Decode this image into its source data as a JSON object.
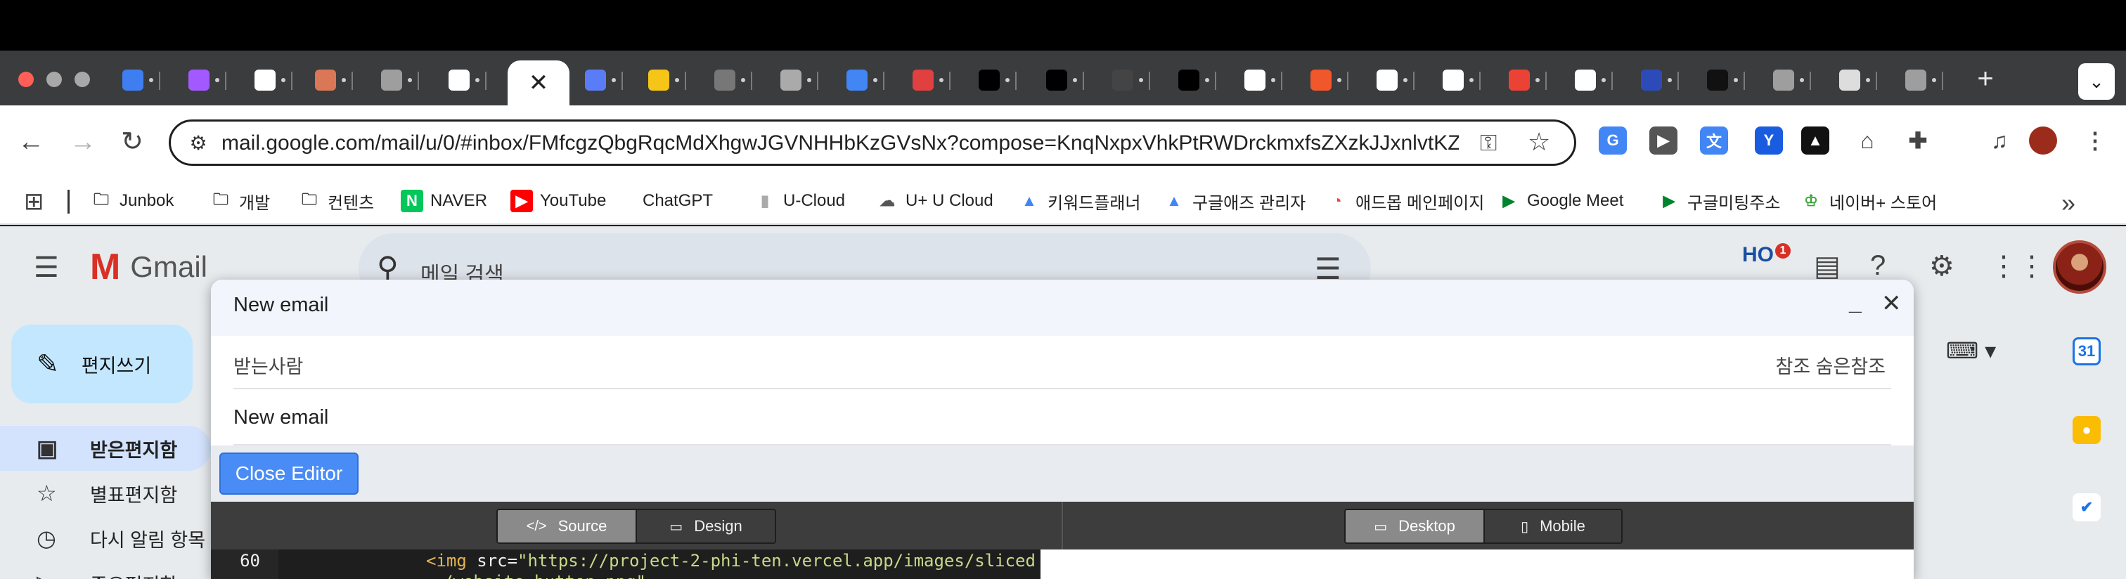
{
  "browser": {
    "tabs": [
      {
        "icon": "diamond-icon",
        "color": "#3f7ef0"
      },
      {
        "icon": "figma-icon",
        "color": "#a259ff"
      },
      {
        "icon": "openai-icon",
        "color": "#ffffff"
      },
      {
        "icon": "claude-icon",
        "color": "#d97757"
      },
      {
        "icon": "globe-icon",
        "color": "#9e9e9e"
      },
      {
        "icon": "slash-icon",
        "color": "#ffffff"
      },
      {
        "icon": "docs-icon",
        "color": "#5b7cf7"
      },
      {
        "icon": "yellow-face-icon",
        "color": "#f5c518"
      },
      {
        "icon": "globe-icon",
        "color": "#777777"
      },
      {
        "icon": "spinner-icon",
        "color": "#aaaaaa"
      },
      {
        "icon": "google-icon",
        "color": "#4285f4"
      },
      {
        "icon": "avatar-icon",
        "color": "#e04040"
      },
      {
        "icon": "triangle-icon",
        "color": "#000000"
      },
      {
        "icon": "triangle-icon",
        "color": "#000000"
      },
      {
        "icon": "github-icon",
        "color": "#444444"
      },
      {
        "icon": "triangle-icon",
        "color": "#000000"
      },
      {
        "icon": "openai-icon",
        "color": "#ffffff"
      },
      {
        "icon": "orange-square-icon",
        "color": "#f0572b"
      },
      {
        "icon": "rounded-square-icon",
        "color": "#ffffff"
      },
      {
        "icon": "rounded-square-icon",
        "color": "#ffffff"
      },
      {
        "icon": "gmail-icon",
        "color": "#ea4335"
      },
      {
        "icon": "rounded-square-icon",
        "color": "#ffffff"
      },
      {
        "icon": "blue-app-icon",
        "color": "#2d4bb8"
      },
      {
        "icon": "tiktok-icon",
        "color": "#111111"
      },
      {
        "icon": "globe-icon",
        "color": "#9e9e9e"
      },
      {
        "icon": "puzzle-icon",
        "color": "#dddddd"
      },
      {
        "icon": "globe-icon",
        "color": "#9e9e9e"
      }
    ],
    "active_tab_close": "✕",
    "new_tab": "+",
    "url": "mail.google.com/mail/u/0/#inbox/FMfcgzQbgRqcMdXhgwJGVNHHbKzGVsNx?compose=KnqNxpxVhkPtRWDrckmxfsZXzkJJxnlvtKZK...",
    "extensions": [
      {
        "icon": "google-translate-icon",
        "label": "G",
        "color": "#4285f4"
      },
      {
        "icon": "video-speed-icon",
        "label": "▶",
        "color": "#555555"
      },
      {
        "icon": "translate-icon",
        "label": "文",
        "color": "#4285f4"
      },
      {
        "icon": "y-logo-icon",
        "label": "Y",
        "color": "#1a5ce0"
      },
      {
        "icon": "triangle-dark-icon",
        "label": "▲",
        "color": "#111111"
      },
      {
        "icon": "robot-icon",
        "label": "⌂",
        "color": "#444444"
      },
      {
        "icon": "extensions-puzzle-icon",
        "label": "✚",
        "color": "#444444"
      },
      {
        "icon": "media-control-icon",
        "label": "♫",
        "color": "#444444"
      },
      {
        "icon": "profile-avatar-icon",
        "label": "",
        "color": "#9b2c1c"
      },
      {
        "icon": "kebab-menu-icon",
        "label": "⋮",
        "color": "#444444"
      }
    ]
  },
  "bookmarks": [
    {
      "label": "Junbok",
      "icon": "folder-icon"
    },
    {
      "label": "개발",
      "icon": "folder-icon"
    },
    {
      "label": "컨텐츠",
      "icon": "folder-icon"
    },
    {
      "label": "NAVER",
      "icon": "naver-icon"
    },
    {
      "label": "YouTube",
      "icon": "youtube-icon"
    },
    {
      "label": "ChatGPT",
      "icon": "openai-icon"
    },
    {
      "label": "U-Cloud",
      "icon": "ucloud-icon"
    },
    {
      "label": "U+ U Cloud",
      "icon": "cloud-icon"
    },
    {
      "label": "키워드플래너",
      "icon": "google-ads-icon"
    },
    {
      "label": "구글애즈 관리자",
      "icon": "google-ads-icon"
    },
    {
      "label": "애드몹 메인페이지",
      "icon": "admob-icon"
    },
    {
      "label": "Google Meet",
      "icon": "google-meet-icon"
    },
    {
      "label": "구글미팅주소",
      "icon": "google-meet-icon"
    },
    {
      "label": "네이버+ 스토어",
      "icon": "naver-store-icon"
    }
  ],
  "gmail": {
    "logo_text": "Gmail",
    "search_placeholder": "메일 검색",
    "compose_label": "편지쓰기",
    "nav": [
      {
        "label": "받은편지함",
        "icon": "inbox-icon"
      },
      {
        "label": "별표편지함",
        "icon": "star-icon"
      },
      {
        "label": "다시 알림 항목",
        "icon": "clock-icon"
      },
      {
        "label": "중요편지함",
        "icon": "important-icon"
      }
    ],
    "badge_count": "1"
  },
  "compose": {
    "title": "New email",
    "to_label": "받는사람",
    "cc_bcc": "참조 숨은참조",
    "subject": "New email",
    "close_editor": "Close Editor",
    "view_modes": [
      "Source",
      "Design"
    ],
    "device_modes": [
      "Desktop",
      "Mobile"
    ],
    "active_view": "Source",
    "active_device": "Desktop",
    "line_number": "60",
    "code": {
      "tag": "<img",
      "attr": " src=",
      "value": "\"https://project-2-phi-ten.vercel.app/images/sliced",
      "continuation": "/website_button.png\""
    }
  },
  "colors": {
    "accent_blue": "#4a8cf5",
    "compose_bg": "#c2e7ff",
    "inbox_highlight": "#d3e3fd"
  }
}
